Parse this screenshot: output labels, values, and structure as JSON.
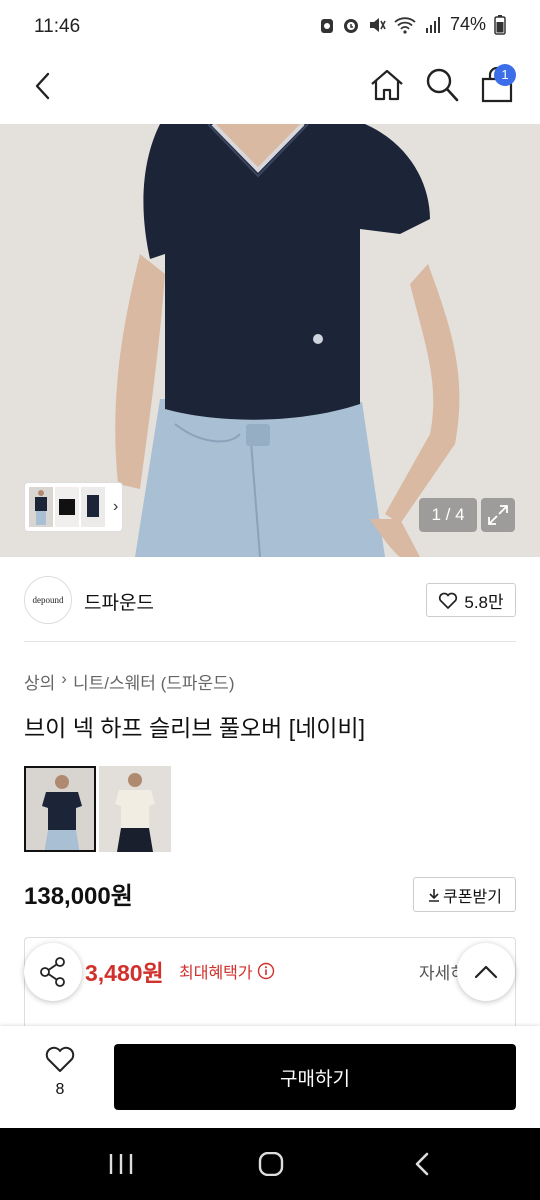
{
  "status_bar": {
    "time": "11:46",
    "battery": "74%"
  },
  "header": {
    "cart_count": "1"
  },
  "gallery": {
    "indicator": "1 / 4",
    "strip_chevron": "›"
  },
  "brand": {
    "logo_text": "depound",
    "name": "드파운드",
    "like_count": "5.8만"
  },
  "breadcrumb": {
    "items": [
      "상의",
      "니트/스웨터 (드파운드)"
    ],
    "separator": "›"
  },
  "product": {
    "title": "브이 넥 하프 슬리브 풀오버 [네이비]",
    "price": "138,000원"
  },
  "coupon": {
    "label": "쿠폰받기"
  },
  "benefit": {
    "price": "3,480원",
    "label": "최대혜택가",
    "detail": "자세히"
  },
  "bottom_bar": {
    "wish_count": "8",
    "buy_label": "구매하기"
  },
  "colors": {
    "navy": "#1c2438",
    "jean": "#a9bfd3",
    "accent_red": "#d0312d",
    "badge_blue": "#3b6ee8"
  }
}
